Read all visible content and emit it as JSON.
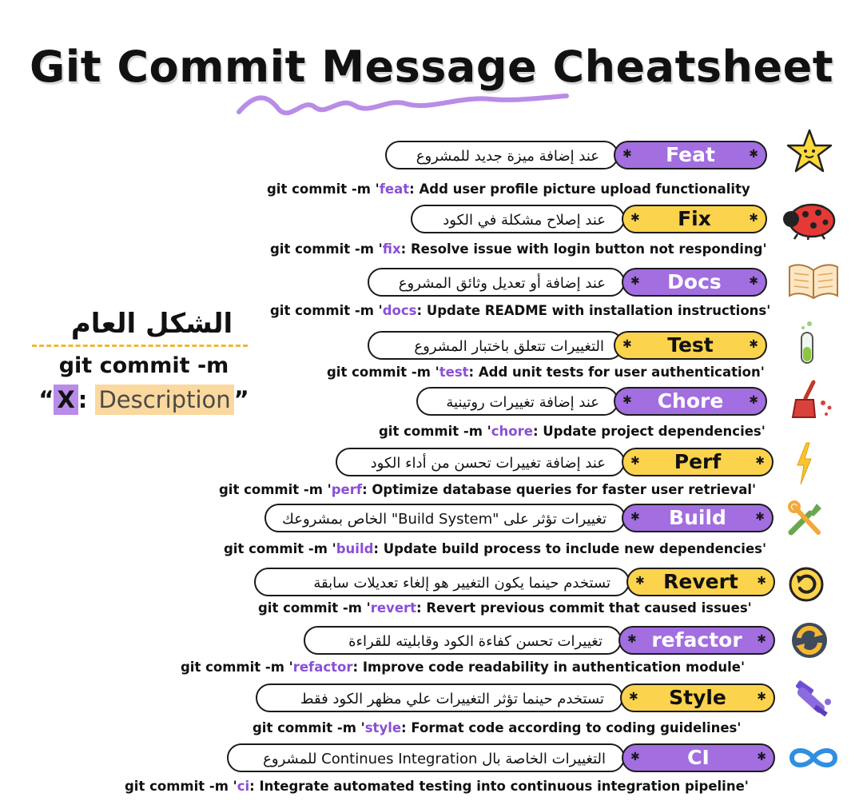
{
  "title": "Git Commit Message Cheatsheet",
  "general": {
    "heading": "الشكل العام",
    "command": "git commit -m",
    "format_open": "“",
    "format_x": "X",
    "format_colon": ":",
    "format_desc": "Description",
    "format_close": "”"
  },
  "colors": {
    "purple": "#a26ee0",
    "yellow": "#fcd34d",
    "keyword": "#8a4fd6",
    "dash": "#f2b632"
  },
  "entries": [
    {
      "type": "Feat",
      "desc": "عند إضافة ميزة جديد للمشروع",
      "prefix": "git commit -m '",
      "keyword": "feat",
      "rest": ": Add user profile picture upload functionality",
      "icon": "star-icon"
    },
    {
      "type": "Fix",
      "desc": "عند إصلاح مشكلة في الكود",
      "prefix": "git commit -m '",
      "keyword": "fix",
      "rest": ": Resolve issue with login button not responding'",
      "icon": "ladybug-icon"
    },
    {
      "type": "Docs",
      "desc": "عند إضافة أو تعديل وثائق المشروع",
      "prefix": "git commit -m '",
      "keyword": "docs",
      "rest": ": Update README with installation instructions'",
      "icon": "book-icon"
    },
    {
      "type": "Test",
      "desc": "التغييرات تتعلق باختبار المشروع",
      "prefix": "git commit -m '",
      "keyword": "test",
      "rest": ": Add unit tests for user authentication'",
      "icon": "test-tube-icon"
    },
    {
      "type": "Chore",
      "desc": "عند إضافة تغييرات روتينية",
      "prefix": "git commit -m '",
      "keyword": "chore",
      "rest": ": Update project dependencies'",
      "icon": "broom-icon"
    },
    {
      "type": "Perf",
      "desc": "عند إضافة تغييرات تحسن من أداء الكود",
      "prefix": "git commit -m '",
      "keyword": "perf",
      "rest": ": Optimize database queries for faster user retrieval'",
      "icon": "lightning-icon"
    },
    {
      "type": "Build",
      "desc": "تغييرات تؤثر على \"Build System\" الخاص بمشروعك",
      "prefix": "git commit -m '",
      "keyword": "build",
      "rest": ": Update build process to include new dependencies'",
      "icon": "tools-icon"
    },
    {
      "type": "Revert",
      "desc": "تستخدم حينما يكون التغيير هو إلغاء تعديلات سابقة",
      "prefix": "git commit -m '",
      "keyword": "revert",
      "rest": ": Revert previous commit that caused issues'",
      "icon": "undo-icon"
    },
    {
      "type": "refactor",
      "desc": "تغييرات تحسن كفاءة الكود وقابليته للقراءة",
      "prefix": "git commit -m '",
      "keyword": "refactor",
      "rest": ": Improve code readability in authentication module'",
      "icon": "refresh-icon"
    },
    {
      "type": "Style",
      "desc": "تستخدم حينما تؤثر التغييرات علي مظهر الكود فقط",
      "prefix": "git commit -m '",
      "keyword": "style",
      "rest": ": Format code according to coding guidelines'",
      "icon": "paint-brush-icon"
    },
    {
      "type": "CI",
      "desc": "التغييرات الخاصة بال Continues Integration للمشروع",
      "prefix": "git commit -m '",
      "keyword": "ci",
      "rest": ": Integrate automated testing into continuous integration pipeline'",
      "icon": "infinity-icon"
    }
  ]
}
